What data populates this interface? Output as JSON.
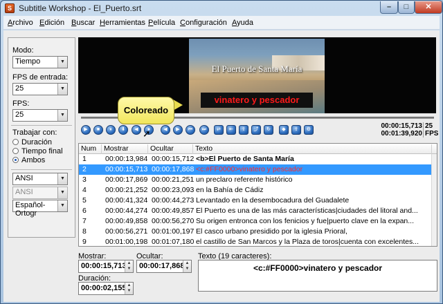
{
  "window": {
    "title": "Subtitle Workshop - El_Puerto.srt",
    "controls": {
      "minimize": "–",
      "maximize": "□",
      "close": "✕"
    }
  },
  "menu": [
    "Archivo",
    "Edición",
    "Buscar",
    "Herramientas",
    "Película",
    "Configuración",
    "Ayuda"
  ],
  "left_panel": {
    "mode_label": "Modo:",
    "mode_value": "Tiempo",
    "fps_input_label": "FPS de entrada:",
    "fps_input_value": "25",
    "fps_label": "FPS:",
    "fps_value": "25",
    "work_with_label": "Trabajar con:",
    "radios": [
      {
        "label": "Duración",
        "checked": false
      },
      {
        "label": "Tiempo final",
        "checked": false
      },
      {
        "label": "Ambos",
        "checked": true
      }
    ],
    "charset1": "ANSI",
    "charset2": "ANSI",
    "language": "Español-Ortogr"
  },
  "video": {
    "caption_top": "El Puerto de Santa María",
    "caption_subtitle": "vinatero y pescador"
  },
  "seek": {
    "position_fraction": 0.16
  },
  "tooltip": "Coloreado",
  "playback": {
    "current_time": "00:00:15,713",
    "total_time": "00:01:39,920",
    "fps_label": "25",
    "fps_unit": "FPS"
  },
  "toolbar_icons": [
    "play-icon",
    "stop-icon",
    "pause-icon",
    "download-icon",
    "rewind-icon",
    "color-icon",
    "back-icon",
    "forward-icon",
    "prev-icon",
    "next-icon",
    "loop-icon",
    "align-icon",
    "upload-icon",
    "jump-icon",
    "sync-icon",
    "mark-icon",
    "export-icon",
    "settings-icon"
  ],
  "table": {
    "headers": [
      "Num",
      "Mostrar",
      "Ocultar",
      "Texto"
    ],
    "rows": [
      {
        "num": "1",
        "show": "00:00:13,984",
        "hide": "00:00:15,712",
        "text": "<b>El Puerto de Santa María",
        "style": "bold"
      },
      {
        "num": "2",
        "show": "00:00:15,713",
        "hide": "00:00:17,868",
        "text": "<c:#FF0000>vinatero y pescador",
        "style": "red",
        "selected": true
      },
      {
        "num": "3",
        "show": "00:00:17,869",
        "hide": "00:00:21,251",
        "text": "un preclaro referente histórico",
        "style": ""
      },
      {
        "num": "4",
        "show": "00:00:21,252",
        "hide": "00:00:23,093",
        "text": "en la Bahía de Cádiz",
        "style": ""
      },
      {
        "num": "5",
        "show": "00:00:41,324",
        "hide": "00:00:44,273",
        "text": "Levantado en la desembocadura del Guadalete",
        "style": ""
      },
      {
        "num": "6",
        "show": "00:00:44,274",
        "hide": "00:00:49,857",
        "text": "El Puerto es una de las más características|ciudades del litoral and...",
        "style": ""
      },
      {
        "num": "7",
        "show": "00:00:49,858",
        "hide": "00:00:56,270",
        "text": "Su origen entronca con los fenicios y fue|puerto clave en la expan...",
        "style": ""
      },
      {
        "num": "8",
        "show": "00:00:56,271",
        "hide": "00:01:00,197",
        "text": "El casco urbano presidido por la iglesia Prioral,",
        "style": ""
      },
      {
        "num": "9",
        "show": "00:01:00,198",
        "hide": "00:01:07,180",
        "text": "el castillo de San Marcos y la Plaza de toros|cuenta con excelentes...",
        "style": ""
      }
    ]
  },
  "editor": {
    "show_label": "Mostrar:",
    "show_value": "00:00:15,713",
    "hide_label": "Ocultar:",
    "hide_value": "00:00:17,868",
    "duration_label": "Duración:",
    "duration_value": "00:00:02,155",
    "text_label": "Texto (19 caracteres):",
    "text_value": "<c:#FF0000>vinatero y pescador"
  }
}
